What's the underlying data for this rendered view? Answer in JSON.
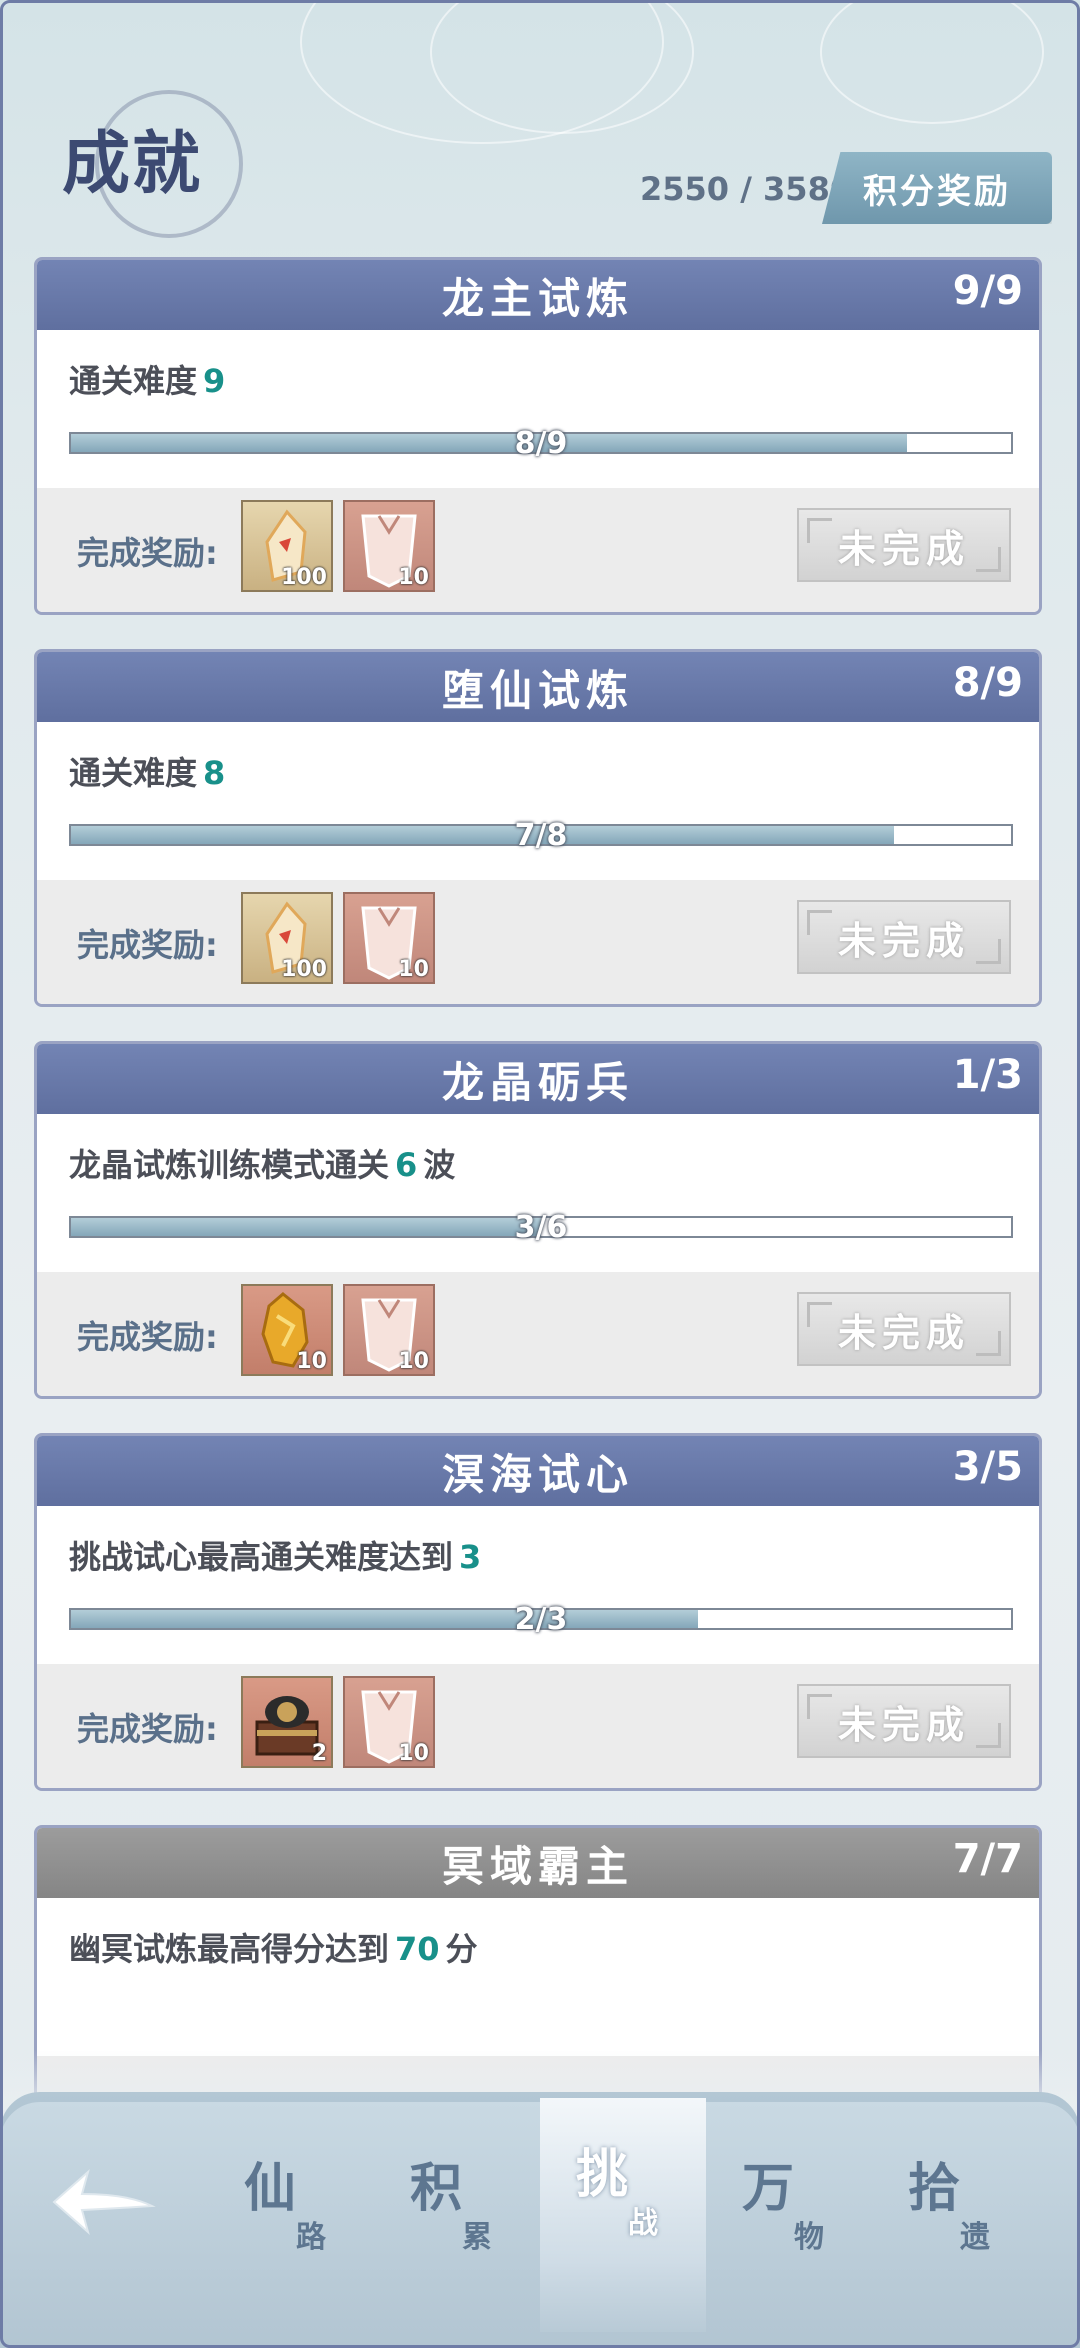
{
  "header": {
    "title": "成就",
    "score": "2550 / 3580",
    "reward_button": "积分奖励"
  },
  "cards": [
    {
      "title": "龙主试炼",
      "count": "9/9",
      "desc_prefix": "通关难度",
      "desc_num": "9",
      "desc_suffix": "",
      "progress_label": "8/9",
      "progress": 0.889,
      "reward_label": "完成奖励:",
      "rewards": [
        {
          "icon": "crystal-shard-icon",
          "qty": "100"
        },
        {
          "icon": "armor-chest-icon",
          "qty": "10"
        }
      ],
      "status": "未完成"
    },
    {
      "title": "堕仙试炼",
      "count": "8/9",
      "desc_prefix": "通关难度",
      "desc_num": "8",
      "desc_suffix": "",
      "progress_label": "7/8",
      "progress": 0.875,
      "reward_label": "完成奖励:",
      "rewards": [
        {
          "icon": "crystal-shard-icon",
          "qty": "100"
        },
        {
          "icon": "armor-chest-icon",
          "qty": "10"
        }
      ],
      "status": "未完成"
    },
    {
      "title": "龙晶砺兵",
      "count": "1/3",
      "desc_prefix": "龙晶试炼训练模式通关",
      "desc_num": "6",
      "desc_suffix": "波",
      "progress_label": "3/6",
      "progress": 0.5,
      "reward_label": "完成奖励:",
      "rewards": [
        {
          "icon": "gold-ore-icon",
          "qty": "10"
        },
        {
          "icon": "armor-chest-icon",
          "qty": "10"
        }
      ],
      "status": "未完成"
    },
    {
      "title": "溟海试心",
      "count": "3/5",
      "desc_prefix": "挑战试心最高通关难度达到",
      "desc_num": "3",
      "desc_suffix": "",
      "progress_label": "2/3",
      "progress": 0.667,
      "reward_label": "完成奖励:",
      "rewards": [
        {
          "icon": "treasure-chest-icon",
          "qty": "2"
        },
        {
          "icon": "armor-chest-icon",
          "qty": "10"
        }
      ],
      "status": "未完成"
    },
    {
      "title": "冥域霸主",
      "count": "7/7",
      "desc_prefix": "幽冥试炼最高得分达到",
      "desc_num": "70",
      "desc_suffix": "分"
    }
  ],
  "nav": {
    "back_icon": "back-arrow-icon",
    "tabs": [
      {
        "main": "仙",
        "sub": "路"
      },
      {
        "main": "积",
        "sub": "累"
      },
      {
        "main": "挑",
        "sub": "战"
      },
      {
        "main": "万",
        "sub": "物"
      },
      {
        "main": "拾",
        "sub": "遗"
      }
    ],
    "active_index": 2
  },
  "colors": {
    "card_header": "#6676a8",
    "accent_number": "#18908a",
    "nav_bg": "#b3c7d4"
  }
}
